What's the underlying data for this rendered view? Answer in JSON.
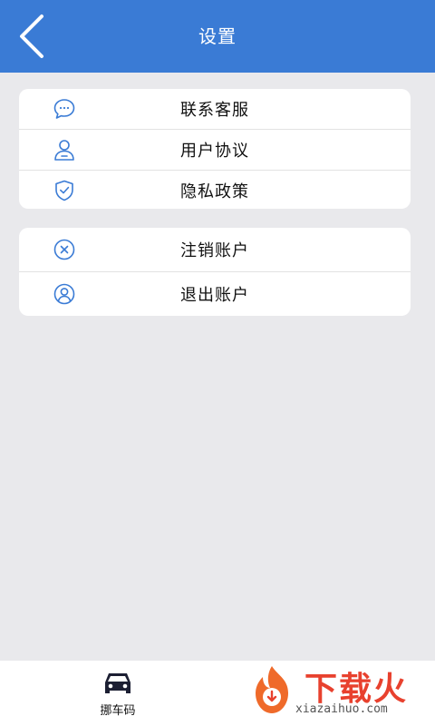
{
  "header": {
    "title": "设置"
  },
  "group1": [
    {
      "label": "联系客服",
      "icon": "chat-icon"
    },
    {
      "label": "用户协议",
      "icon": "user-agreement-icon"
    },
    {
      "label": "隐私政策",
      "icon": "shield-check-icon"
    }
  ],
  "group2": [
    {
      "label": "注销账户",
      "icon": "circle-x-icon"
    },
    {
      "label": "退出账户",
      "icon": "user-circle-icon"
    }
  ],
  "tabbar": {
    "tab_label": "挪车码",
    "icon": "car-icon"
  },
  "watermark": {
    "text": "下载火",
    "url": "xiazaihuo.com"
  },
  "colors": {
    "primary": "#3a7bd5",
    "background": "#e9e9ec",
    "watermark": "#e8412e"
  }
}
